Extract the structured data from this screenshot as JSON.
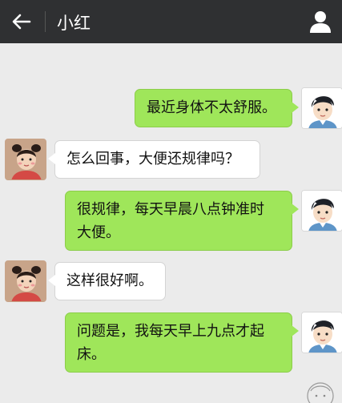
{
  "header": {
    "title": "小红",
    "back_icon": "arrow-left-icon",
    "profile_icon": "person-icon"
  },
  "colors": {
    "header_bg": "#2f3032",
    "chat_bg": "#ebebeb",
    "outgoing_bubble": "#9fe65a",
    "incoming_bubble": "#ffffff"
  },
  "messages": [
    {
      "sender": "me",
      "text": "最近身体不太舒服。"
    },
    {
      "sender": "xiaohong",
      "text": "怎么回事，大便还规律吗？"
    },
    {
      "sender": "me",
      "line1": "很规律，每天早晨八点钟准时",
      "line2": "大便。"
    },
    {
      "sender": "xiaohong",
      "text": "这样很好啊。"
    },
    {
      "sender": "me",
      "line1": "问题是，我每天早上九点才起",
      "line2": "床。"
    }
  ]
}
